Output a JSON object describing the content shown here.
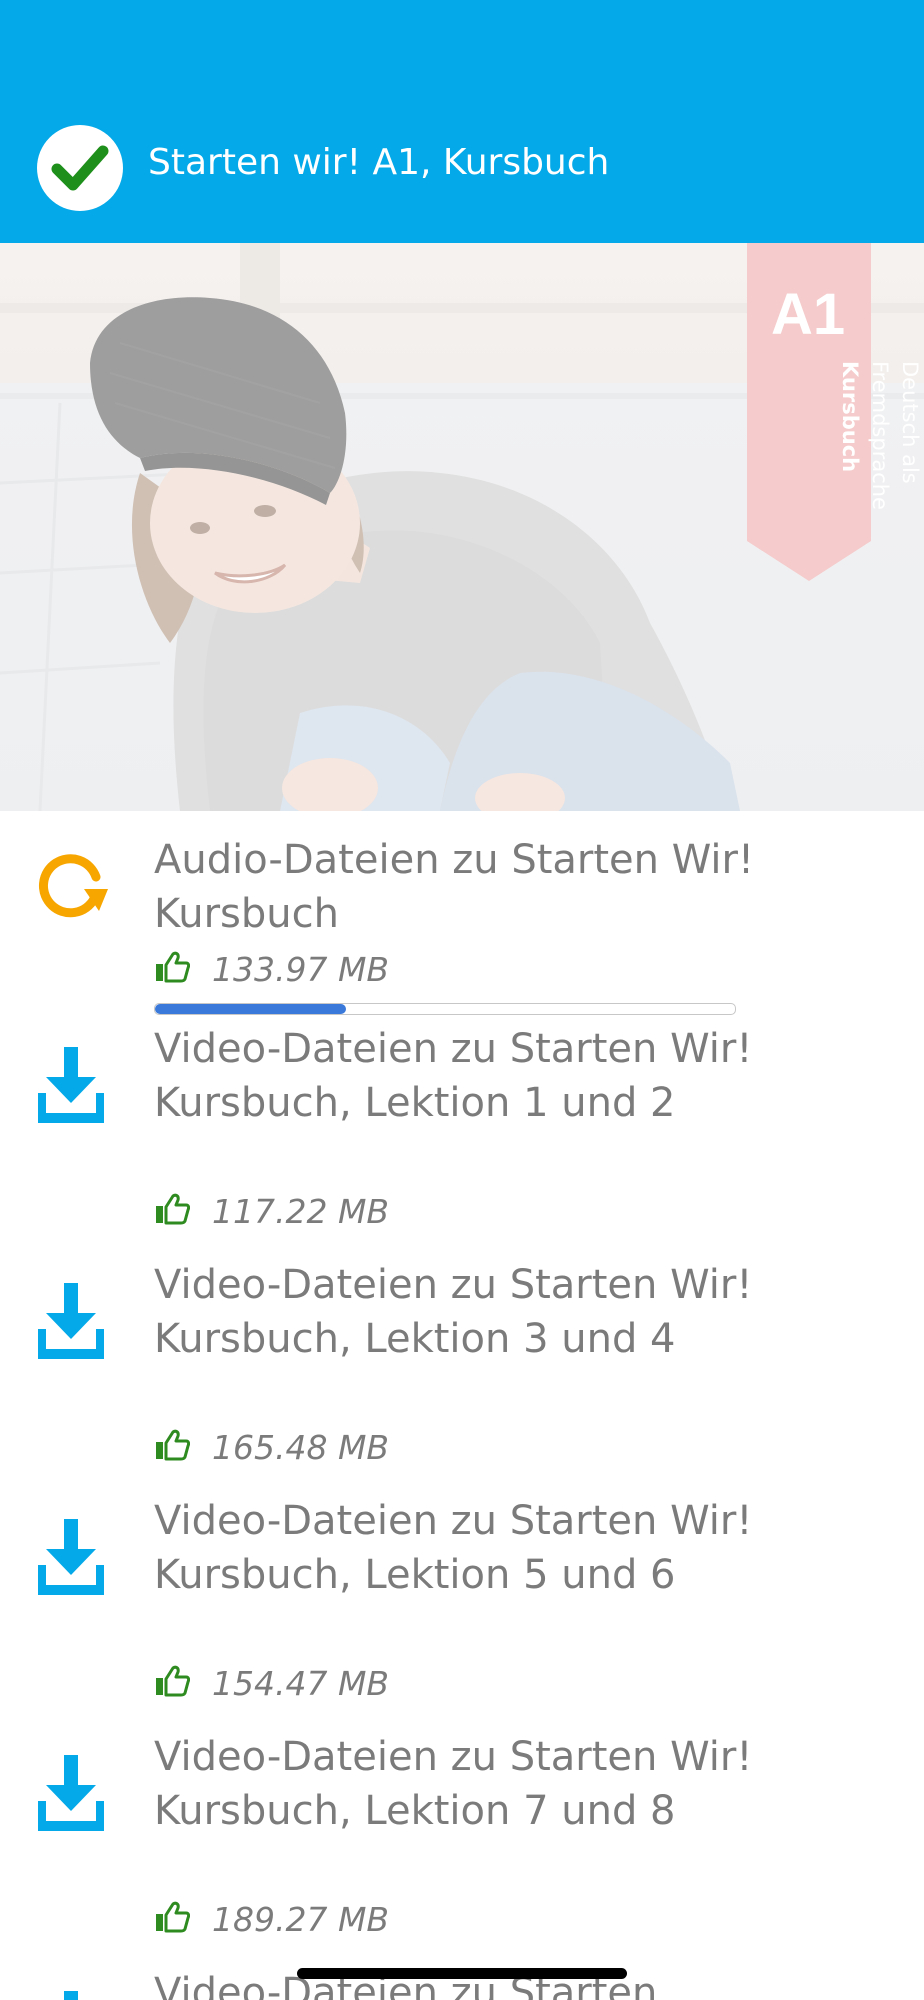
{
  "header": {
    "title": "Starten wir! A1, Kursbuch",
    "status_icon": "check-circle-icon"
  },
  "cover": {
    "level": "A1",
    "subtitle_line1": "Deutsch als",
    "subtitle_line2": "Fremdsprache",
    "subtitle_line3": "Kursbuch"
  },
  "items": [
    {
      "name": "Audio-Dateien zu Starten Wir! Kursbuch",
      "size": "133.97 MB",
      "state": "downloading",
      "icon": "refresh-icon",
      "progress": 0.33
    },
    {
      "name": "Video-Dateien zu Starten Wir! Kursbuch, Lektion 1 und 2",
      "size": "117.22 MB",
      "state": "available",
      "icon": "download-icon"
    },
    {
      "name": "Video-Dateien zu Starten Wir! Kursbuch, Lektion 3 und 4",
      "size": "165.48 MB",
      "state": "available",
      "icon": "download-icon"
    },
    {
      "name": "Video-Dateien zu Starten Wir! Kursbuch, Lektion 5 und 6",
      "size": "154.47 MB",
      "state": "available",
      "icon": "download-icon"
    },
    {
      "name": "Video-Dateien zu Starten Wir! Kursbuch, Lektion 7 und 8",
      "size": "189.27 MB",
      "state": "available",
      "icon": "download-icon"
    },
    {
      "name": "Video-Dateien zu Starten",
      "state": "available",
      "icon": "download-icon"
    }
  ],
  "colors": {
    "header_bg": "#03a9e8",
    "download_blue": "#03a9e8",
    "refresh_orange": "#f7a600",
    "thumb_green": "#2e8b1f",
    "progress_fill": "#3a78d9",
    "text_gray": "#7b7b7b"
  }
}
